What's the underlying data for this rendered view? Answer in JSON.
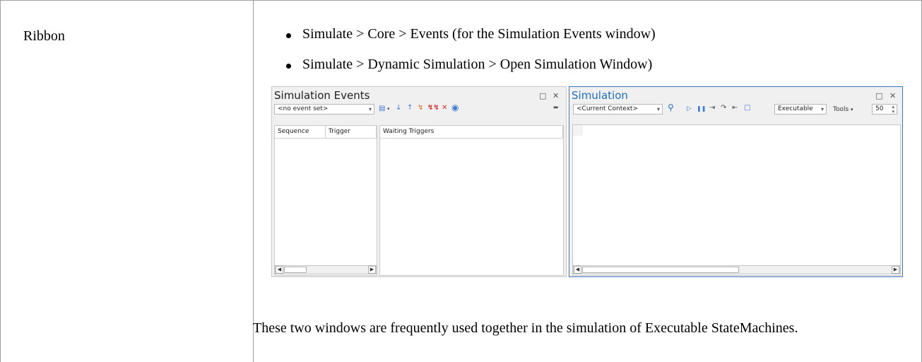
{
  "row": {
    "label": "Ribbon",
    "bullets": [
      "Simulate > Core > Events   (for the Simulation Events window)",
      "Simulate > Dynamic Simulation > Open Simulation Window)"
    ],
    "description": "These two windows are frequently used together in the simulation of Executable StateMachines."
  },
  "events_window": {
    "title": "Simulation Events",
    "event_set": "<no event set>",
    "columns": [
      "Sequence",
      "Trigger",
      "Waiting Triggers"
    ]
  },
  "simulation_window": {
    "title": "Simulation",
    "context": "<Current Context>",
    "mode": "Executable",
    "tools_label": "Tools",
    "speed": "50"
  },
  "colors": {
    "active_title": "#1e6fc7",
    "active_border": "#3c79c3",
    "inactive_border": "#c8c8c8",
    "toolbar_icon_blue": "#3b7dd8",
    "toolbar_icon_red": "#d83030"
  },
  "icons": {
    "restore": "restore-icon",
    "close": "close-icon",
    "search": "search-icon",
    "play": "play-icon",
    "pause": "pause-icon"
  }
}
